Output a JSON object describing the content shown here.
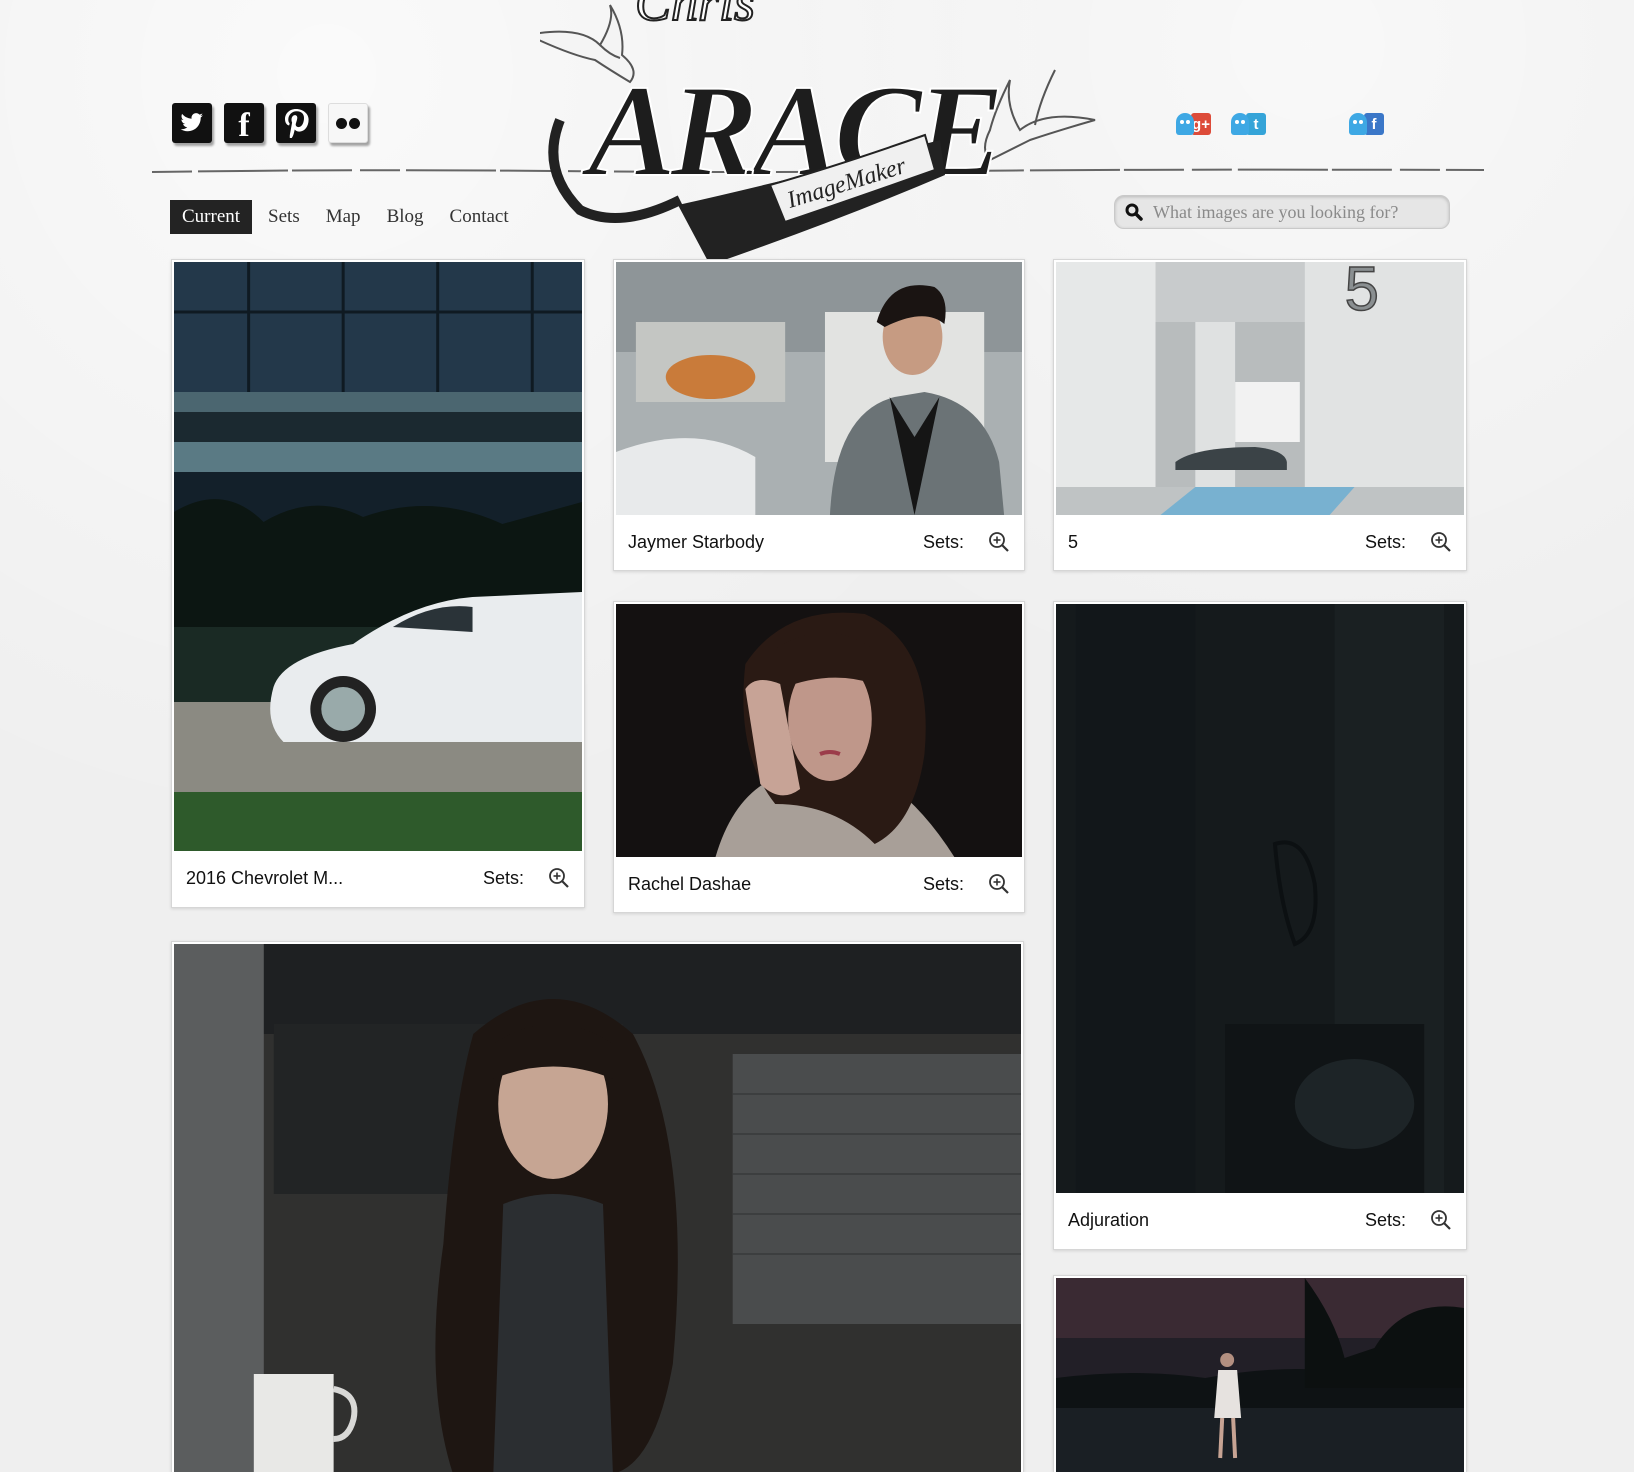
{
  "header": {
    "logo": {
      "top_script": "Chris",
      "name": "ARACE",
      "banner": "ImageMaker"
    },
    "social_icons": [
      {
        "name": "twitter",
        "glyph": "✶"
      },
      {
        "name": "facebook",
        "glyph": "f"
      },
      {
        "name": "pinterest",
        "glyph": "P"
      },
      {
        "name": "flickr",
        "glyph": "●●"
      }
    ],
    "share_buttons": [
      {
        "network": "google-plus",
        "label": "g+",
        "color": "#dd4b39"
      },
      {
        "network": "tumblr",
        "label": "t",
        "color": "#35a4d8"
      },
      {
        "network": "facebook",
        "label": "f",
        "color": "#3b77c8"
      }
    ],
    "nav": [
      {
        "label": "Current",
        "active": true
      },
      {
        "label": "Sets",
        "active": false
      },
      {
        "label": "Map",
        "active": false
      },
      {
        "label": "Blog",
        "active": false
      },
      {
        "label": "Contact",
        "active": false
      }
    ],
    "search": {
      "placeholder": "What images are you looking for?"
    }
  },
  "gallery": {
    "sets_label": "Sets:",
    "items": [
      {
        "title": "2016 Chevrolet M...",
        "scene": "car"
      },
      {
        "title": "Jaymer Starbody",
        "scene": "portrait-suit"
      },
      {
        "title": "5",
        "scene": "garage"
      },
      {
        "title": "Rachel Dashae",
        "scene": "portrait-dark"
      },
      {
        "title": "Adjuration",
        "scene": "dark-room"
      },
      {
        "title": "",
        "scene": "kitchen-portrait"
      },
      {
        "title": "",
        "scene": "dusk-figure"
      }
    ]
  },
  "colors": {
    "nav_active_bg": "#232323",
    "page_bg": "#efefef",
    "share_ghost": "#3ea8e4"
  }
}
